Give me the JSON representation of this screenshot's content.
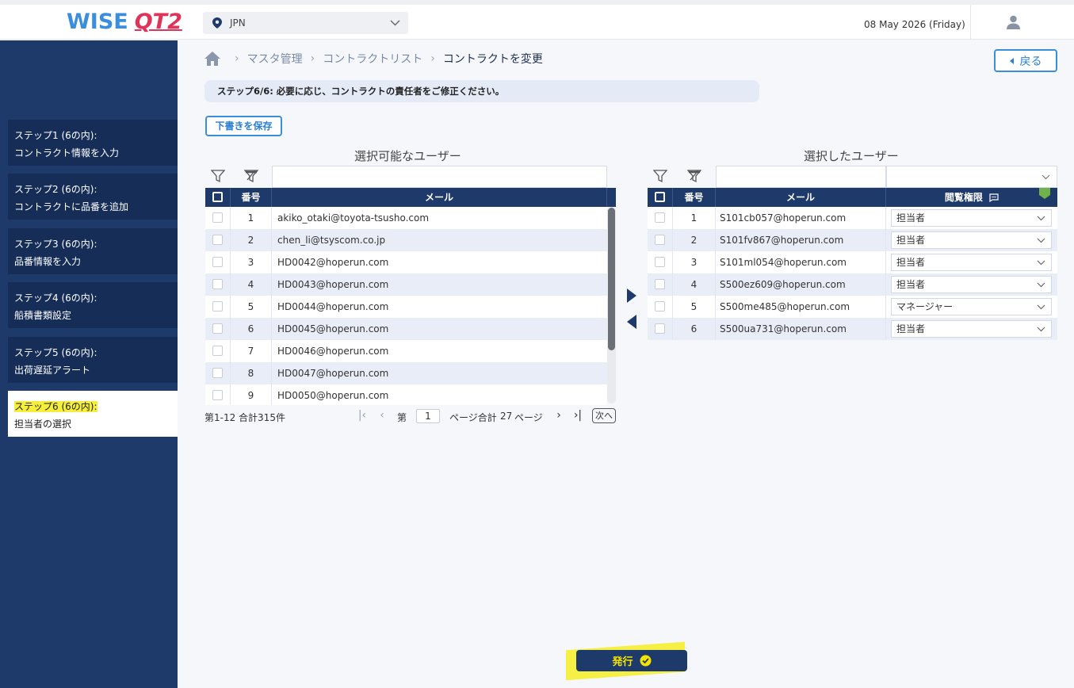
{
  "header": {
    "logo_wise": "WISE",
    "logo_qt": "QT2",
    "region": "JPN",
    "date": "08 May 2026 (Friday)",
    "icons": [
      "location-pin-icon",
      "chevron-down-icon",
      "user-icon"
    ]
  },
  "sidebar": {
    "steps": [
      {
        "title": "ステップ1 (6の内):",
        "desc": "コントラクト情報を入力"
      },
      {
        "title": "ステップ2 (6の内):",
        "desc": "コントラクトに品番を追加"
      },
      {
        "title": "ステップ3 (6の内):",
        "desc": "品番情報を入力"
      },
      {
        "title": "ステップ4 (6の内):",
        "desc": "船積書類設定"
      },
      {
        "title": "ステップ5 (6の内):",
        "desc": "出荷遅延アラート"
      },
      {
        "title": "ステップ6 (6の内):",
        "desc": "担当者の選択"
      }
    ]
  },
  "breadcrumb": {
    "items": [
      "マスタ管理",
      "コントラクトリスト",
      "コントラクトを変更"
    ]
  },
  "back_label": "戻る",
  "notice": "ステップ6/6: 必要に応じ、コントラクトの責任者をご修正ください。",
  "draft_label": "下書きを保存",
  "available": {
    "title": "選択可能なユーザー",
    "col_no": "番号",
    "col_mail": "メール",
    "rows": [
      {
        "no": "1",
        "mail": "akiko_otaki@toyota-tsusho.com"
      },
      {
        "no": "2",
        "mail": "chen_li@tsyscom.co.jp"
      },
      {
        "no": "3",
        "mail": "HD0042@hoperun.com"
      },
      {
        "no": "4",
        "mail": "HD0043@hoperun.com"
      },
      {
        "no": "5",
        "mail": "HD0044@hoperun.com"
      },
      {
        "no": "6",
        "mail": "HD0045@hoperun.com"
      },
      {
        "no": "7",
        "mail": "HD0046@hoperun.com"
      },
      {
        "no": "8",
        "mail": "HD0047@hoperun.com"
      },
      {
        "no": "9",
        "mail": "HD0050@hoperun.com"
      }
    ],
    "pager": {
      "count": "第1-12 合計315件",
      "page_prefix": "第",
      "page": "1",
      "page_suffix": "ページ合計",
      "total": "27",
      "total_suffix": "ページ",
      "next": "次へ"
    }
  },
  "selected": {
    "title": "選択したユーザー",
    "col_no": "番号",
    "col_mail": "メール",
    "col_perm": "閲覧権限",
    "rows": [
      {
        "no": "1",
        "mail": "S101cb057@hoperun.com",
        "perm": "担当者"
      },
      {
        "no": "2",
        "mail": "S101fv867@hoperun.com",
        "perm": "担当者"
      },
      {
        "no": "3",
        "mail": "S101ml054@hoperun.com",
        "perm": "担当者"
      },
      {
        "no": "4",
        "mail": "S500ez609@hoperun.com",
        "perm": "担当者"
      },
      {
        "no": "5",
        "mail": "S500me485@hoperun.com",
        "perm": "マネージャー"
      },
      {
        "no": "6",
        "mail": "S500ua731@hoperun.com",
        "perm": "担当者"
      }
    ]
  },
  "issue_label": "発行",
  "colors": {
    "navy": "#1e3a6b",
    "accent": "#3a8edb",
    "highlight": "#f5ee3a"
  }
}
